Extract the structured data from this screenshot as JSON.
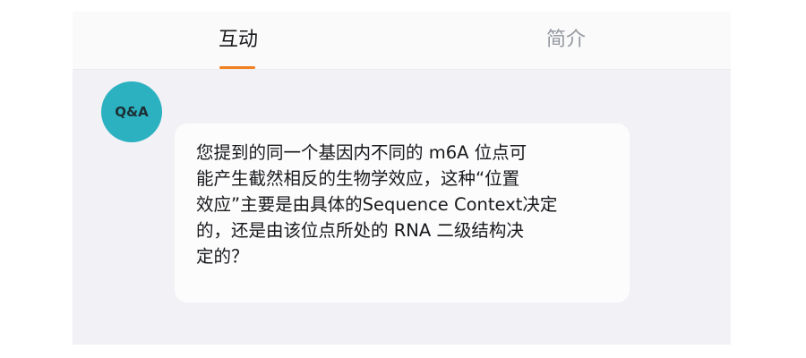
{
  "tabs": {
    "interaction_label": "互动",
    "intro_label": "简介"
  },
  "colors": {
    "active_indicator": "#f08020",
    "avatar_background": "#2cb1c1"
  },
  "message": {
    "avatar_label": "Q&A",
    "text": "您提到的同一个基因内不同的 m6A 位点可\n能产生截然相反的生物学效应，这种“位置\n效应”主要是由具体的Sequence Context决定\n的，还是由该位点所处的 RNA 二级结构决\n定的？"
  }
}
